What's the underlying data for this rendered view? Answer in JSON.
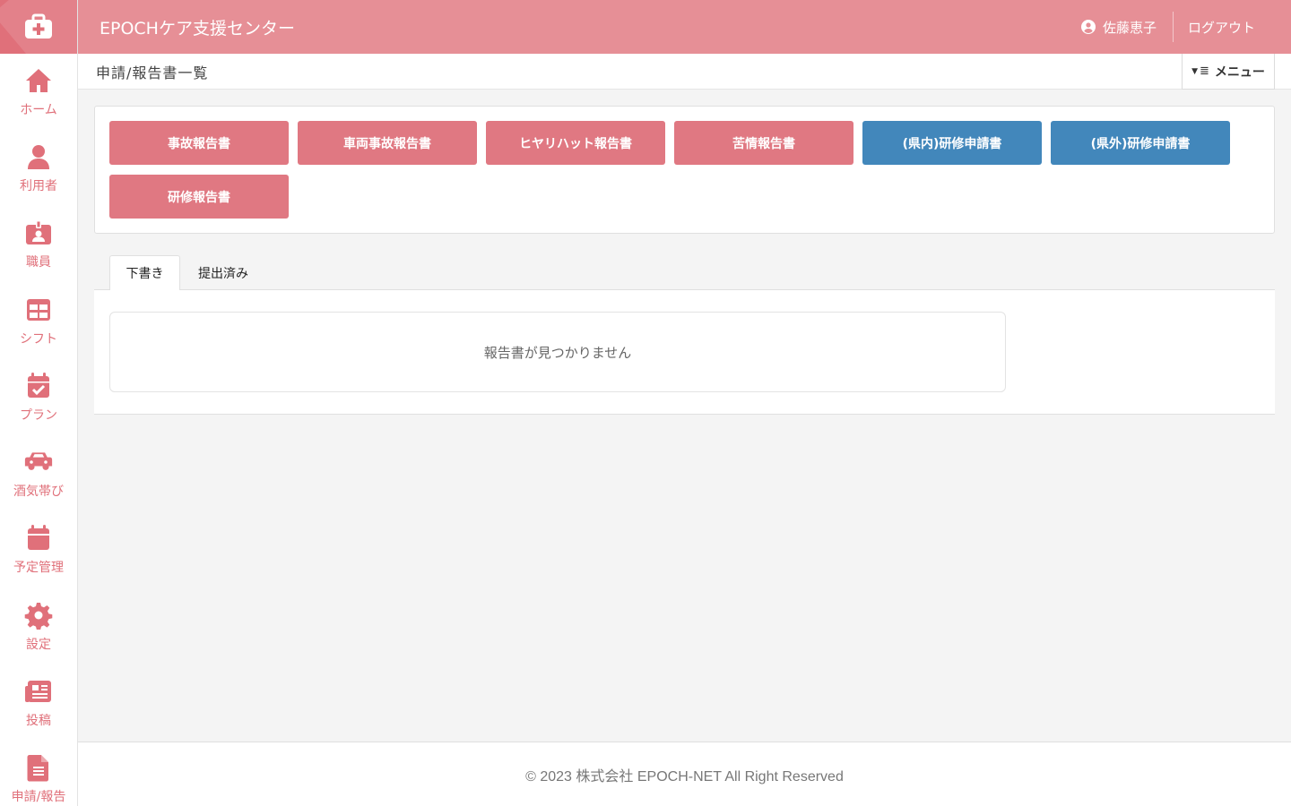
{
  "app": {
    "title": "EPOCHケア支援センター"
  },
  "header": {
    "user_name": "佐藤恵子",
    "logout_label": "ログアウト"
  },
  "sidebar": {
    "items": [
      {
        "label": "ホーム",
        "icon": "home-icon"
      },
      {
        "label": "利用者",
        "icon": "user-icon"
      },
      {
        "label": "職員",
        "icon": "id-badge-icon"
      },
      {
        "label": "シフト",
        "icon": "table-icon"
      },
      {
        "label": "プラン",
        "icon": "calendar-check-icon"
      },
      {
        "label": "酒気帯び",
        "icon": "car-icon"
      },
      {
        "label": "予定管理",
        "icon": "calendar-icon"
      },
      {
        "label": "設定",
        "icon": "gear-icon"
      },
      {
        "label": "投稿",
        "icon": "newspaper-icon"
      },
      {
        "label": "申請/報告",
        "icon": "file-icon"
      }
    ]
  },
  "page": {
    "title": "申請/報告書一覧",
    "menu_label": "メニュー"
  },
  "buttons": [
    {
      "label": "事故報告書",
      "color": "#e07882"
    },
    {
      "label": "車両事故報告書",
      "color": "#e07882"
    },
    {
      "label": "ヒヤリハット報告書",
      "color": "#e07882"
    },
    {
      "label": "苦情報告書",
      "color": "#e07882"
    },
    {
      "label": "(県内)研修申請書",
      "color": "#4287bb"
    },
    {
      "label": "(県外)研修申請書",
      "color": "#4287bb"
    },
    {
      "label": "研修報告書",
      "color": "#e07882"
    }
  ],
  "tabs": [
    {
      "label": "下書き",
      "active": true
    },
    {
      "label": "提出済み",
      "active": false
    }
  ],
  "empty_message": "報告書が見つかりません",
  "footer": {
    "text": "© 2023 株式会社 EPOCH-NET All Right Reserved"
  }
}
